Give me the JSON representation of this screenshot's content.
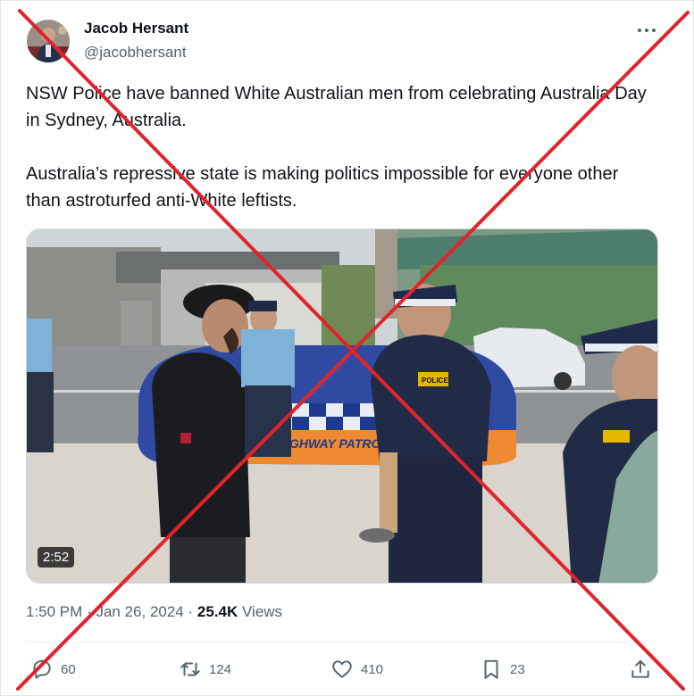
{
  "author": {
    "name": "Jacob Hersant",
    "handle": "@jacobhersant"
  },
  "tweet": {
    "paragraphs": [
      "NSW Police have banned White Australian men from celebrating Australia Day in Sydney, Australia.",
      "Australia’s repressive state is making politics impossible for everyone other than astroturfed anti-White leftists."
    ]
  },
  "media": {
    "duration": "2:52",
    "vehicle_text": "HIGHWAY PATROL",
    "vest_text": "POLICE"
  },
  "meta": {
    "time": "1:50 PM",
    "separator": "·",
    "date": "Jan 26, 2024",
    "views_count": "25.4K",
    "views_label": "Views"
  },
  "actions": {
    "replies": "60",
    "reposts": "124",
    "likes": "410",
    "bookmarks": "23"
  },
  "icons": [
    "more-icon",
    "reply-icon",
    "repost-icon",
    "like-icon",
    "bookmark-icon",
    "share-icon"
  ],
  "overlay": {
    "color": "#e0242b"
  }
}
